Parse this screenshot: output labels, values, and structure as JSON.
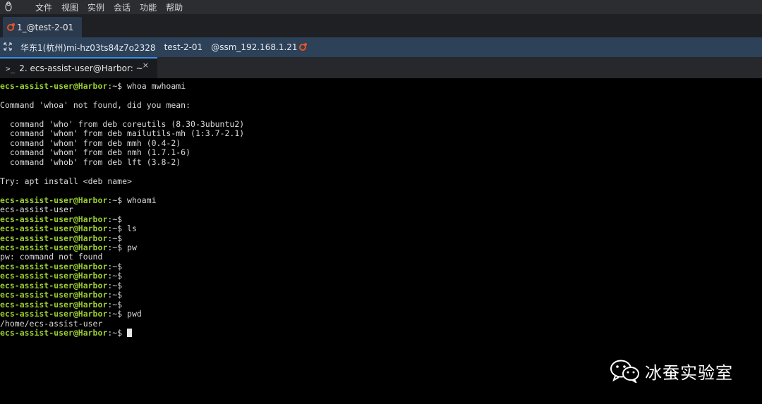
{
  "menu": {
    "items": [
      "文件",
      "视图",
      "实例",
      "会话",
      "功能",
      "帮助"
    ]
  },
  "session_tab": {
    "label": "1_@test-2-01"
  },
  "infobar": {
    "region": "华东1(杭州)mi-hz03ts84z7o2328",
    "instance": "test-2-01",
    "connection": "@ssm_192.168.1.21"
  },
  "terminal_tab": {
    "label": "2. ecs-assist-user@Harbor: ~",
    "close": "×"
  },
  "terminal": {
    "prompt": "ecs-assist-user@Harbor",
    "suffix": ":~$",
    "lines": [
      {
        "prompt": true,
        "cmd": " whoa mwhoami"
      },
      {
        "text": ""
      },
      {
        "text": "Command 'whoa' not found, did you mean:"
      },
      {
        "text": ""
      },
      {
        "text": "  command 'who' from deb coreutils (8.30-3ubuntu2)"
      },
      {
        "text": "  command 'whom' from deb mailutils-mh (1:3.7-2.1)"
      },
      {
        "text": "  command 'whom' from deb mmh (0.4-2)"
      },
      {
        "text": "  command 'whom' from deb nmh (1.7.1-6)"
      },
      {
        "text": "  command 'whob' from deb lft (3.8-2)"
      },
      {
        "text": ""
      },
      {
        "text": "Try: apt install <deb name>"
      },
      {
        "text": ""
      },
      {
        "prompt": true,
        "cmd": " whoami"
      },
      {
        "text": "ecs-assist-user"
      },
      {
        "prompt": true,
        "cmd": ""
      },
      {
        "prompt": true,
        "cmd": " ls"
      },
      {
        "prompt": true,
        "cmd": ""
      },
      {
        "prompt": true,
        "cmd": " pw"
      },
      {
        "text": "pw: command not found"
      },
      {
        "prompt": true,
        "cmd": ""
      },
      {
        "prompt": true,
        "cmd": ""
      },
      {
        "prompt": true,
        "cmd": ""
      },
      {
        "prompt": true,
        "cmd": ""
      },
      {
        "prompt": true,
        "cmd": ""
      },
      {
        "prompt": true,
        "cmd": " pwd"
      },
      {
        "text": "/home/ecs-assist-user"
      },
      {
        "prompt": true,
        "cmd": " ",
        "cursor": true
      }
    ]
  },
  "watermark": {
    "text": "冰蚕实验室"
  },
  "colors": {
    "prompt": "#9acd32",
    "infobar": "#2d4158",
    "tab_accent": "#3a8ee6",
    "ubuntu": "#e95420"
  },
  "icons": {
    "app_logo": "penguin-icon",
    "session_os": "ubuntu-icon",
    "expand": "expand-arrows-icon",
    "terminal_tab": "terminal-prompt-icon",
    "close": "close-icon",
    "wechat": "wechat-icon"
  }
}
